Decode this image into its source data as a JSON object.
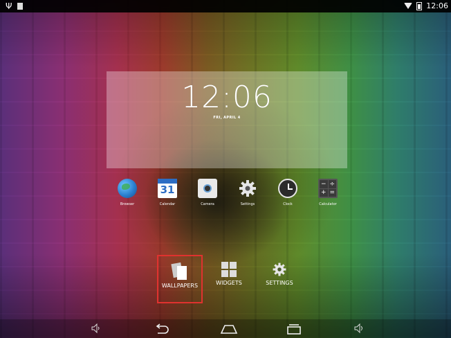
{
  "status_bar": {
    "time": "12:06",
    "usb_icon": "usb-icon",
    "notification_icon": "notification-icon",
    "wifi_icon": "wifi-icon",
    "battery_icon": "battery-icon"
  },
  "clock_widget": {
    "time": "12:06",
    "date": "FRI, APRIL 4"
  },
  "apps": [
    {
      "label": "Browser",
      "icon": "browser-icon"
    },
    {
      "label": "Calendar",
      "icon": "calendar-icon",
      "day": "31"
    },
    {
      "label": "Camera",
      "icon": "camera-icon"
    },
    {
      "label": "Settings",
      "icon": "gear-icon"
    },
    {
      "label": "Clock",
      "icon": "clock-icon"
    },
    {
      "label": "Calculator",
      "icon": "calculator-icon"
    }
  ],
  "options": {
    "wallpapers": "WALLPAPERS",
    "widgets": "WIDGETS",
    "settings": "SETTINGS"
  },
  "nav_bar": {
    "items": [
      "volume-down-icon",
      "back-icon",
      "home-icon",
      "recent-apps-icon",
      "volume-up-icon"
    ]
  },
  "colors": {
    "highlight": "#e0322f",
    "status_bar_bg": "#000000"
  }
}
